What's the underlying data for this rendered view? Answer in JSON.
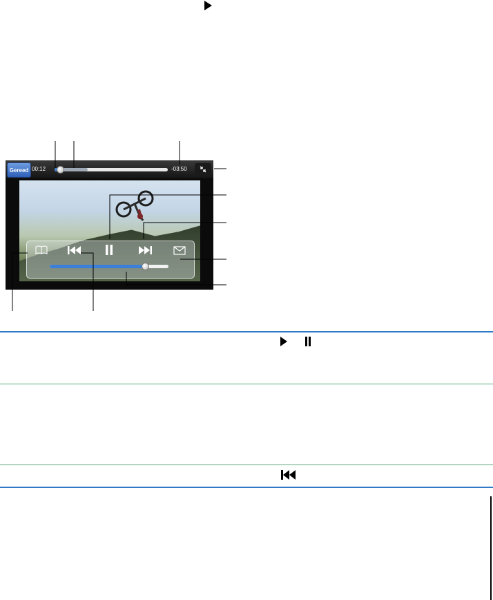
{
  "header": {
    "play_icon": "play-triangle-icon"
  },
  "player": {
    "done_label": "Gereed",
    "elapsed": "00:12",
    "remaining": "-03:50",
    "progress": 0.05,
    "buffered": 0.29,
    "volume": 0.8
  },
  "table": {
    "row1_icons": [
      "play-icon",
      "pause-icon"
    ],
    "row3_icon": "previous-chapter-icon"
  },
  "colors": {
    "rule_blue": "#2f7ac7",
    "rule_green": "#5aa67a",
    "accent_blue": "#3b7fd8"
  }
}
